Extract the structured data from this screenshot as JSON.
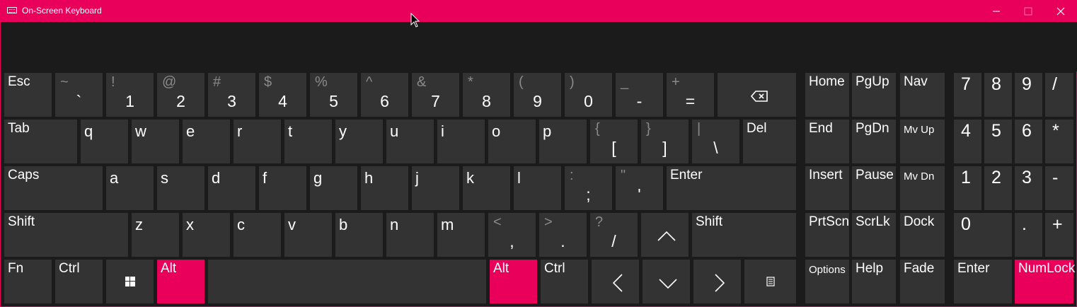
{
  "window": {
    "title": "On-Screen Keyboard"
  },
  "titlebar": {
    "minimize": "—",
    "maximize": "☐",
    "close": "✕"
  },
  "colors": {
    "accent": "#e8005b",
    "key": "#333333",
    "background": "#1b1b1b"
  },
  "row1": [
    {
      "label": "Esc"
    },
    {
      "shift": "~",
      "main": "`"
    },
    {
      "shift": "!",
      "main": "1"
    },
    {
      "shift": "@",
      "main": "2"
    },
    {
      "shift": "#",
      "main": "3"
    },
    {
      "shift": "$",
      "main": "4"
    },
    {
      "shift": "%",
      "main": "5"
    },
    {
      "shift": "^",
      "main": "6"
    },
    {
      "shift": "&",
      "main": "7"
    },
    {
      "shift": "*",
      "main": "8"
    },
    {
      "shift": "(",
      "main": "9"
    },
    {
      "shift": ")",
      "main": "0"
    },
    {
      "shift": "_",
      "main": "-"
    },
    {
      "shift": "+",
      "main": "="
    },
    {
      "icon": "backspace-icon"
    }
  ],
  "row2": [
    {
      "label": "Tab"
    },
    {
      "letter": "q"
    },
    {
      "letter": "w"
    },
    {
      "letter": "e"
    },
    {
      "letter": "r"
    },
    {
      "letter": "t"
    },
    {
      "letter": "y"
    },
    {
      "letter": "u"
    },
    {
      "letter": "i"
    },
    {
      "letter": "o"
    },
    {
      "letter": "p"
    },
    {
      "shift": "{",
      "main": "["
    },
    {
      "shift": "}",
      "main": "]"
    },
    {
      "shift": "|",
      "main": "\\"
    },
    {
      "label": "Del"
    }
  ],
  "row3": [
    {
      "label": "Caps"
    },
    {
      "letter": "a"
    },
    {
      "letter": "s"
    },
    {
      "letter": "d"
    },
    {
      "letter": "f"
    },
    {
      "letter": "g"
    },
    {
      "letter": "h"
    },
    {
      "letter": "j"
    },
    {
      "letter": "k"
    },
    {
      "letter": "l"
    },
    {
      "shift": ":",
      "main": ";"
    },
    {
      "shift": "\"",
      "main": "'"
    },
    {
      "label": "Enter"
    }
  ],
  "row4": [
    {
      "label": "Shift"
    },
    {
      "letter": "z"
    },
    {
      "letter": "x"
    },
    {
      "letter": "c"
    },
    {
      "letter": "v"
    },
    {
      "letter": "b"
    },
    {
      "letter": "n"
    },
    {
      "letter": "m"
    },
    {
      "shift": "<",
      "main": ","
    },
    {
      "shift": ">",
      "main": "."
    },
    {
      "shift": "?",
      "main": "/"
    },
    {
      "icon": "arrow-up-icon"
    },
    {
      "label": "Shift"
    }
  ],
  "row5": [
    {
      "label": "Fn"
    },
    {
      "label": "Ctrl"
    },
    {
      "icon": "windows-icon"
    },
    {
      "label": "Alt",
      "active": true
    },
    {
      "label": ""
    },
    {
      "label": "Alt",
      "active": true
    },
    {
      "label": "Ctrl"
    },
    {
      "icon": "arrow-left-icon"
    },
    {
      "icon": "arrow-down-icon"
    },
    {
      "icon": "arrow-right-icon"
    },
    {
      "icon": "menu-icon"
    }
  ],
  "nav": [
    [
      "Home",
      "PgUp",
      "Nav"
    ],
    [
      "End",
      "PgDn",
      "Mv Up"
    ],
    [
      "Insert",
      "Pause",
      "Mv Dn"
    ],
    [
      "PrtScn",
      "ScrLk",
      "Dock"
    ],
    [
      "Options",
      "Help",
      "Fade"
    ]
  ],
  "numpad": [
    [
      "7",
      "8",
      "9",
      "/"
    ],
    [
      "4",
      "5",
      "6",
      "*"
    ],
    [
      "1",
      "2",
      "3",
      "-"
    ],
    [
      "0",
      "",
      ".",
      "+"
    ],
    [
      "Enter",
      "NumLock"
    ]
  ]
}
